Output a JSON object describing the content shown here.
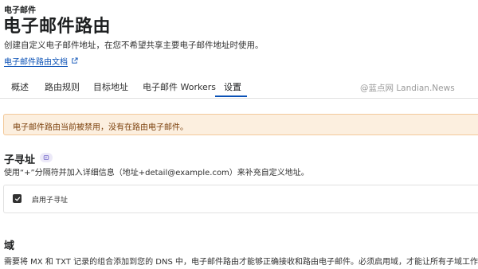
{
  "header": {
    "breadcrumb": "电子邮件",
    "title": "电子邮件路由",
    "subtitle": "创建自定义电子邮件地址，在您不希望共享主要电子邮件地址时使用。",
    "docs_link": "电子邮件路由文档"
  },
  "tabs": [
    {
      "label": "概述"
    },
    {
      "label": "路由规则"
    },
    {
      "label": "目标地址"
    },
    {
      "label": "电子邮件 Workers"
    },
    {
      "label": "设置"
    }
  ],
  "active_tab": "设置",
  "watermark": "@蓝点网 Landian.News",
  "alert": {
    "text": "电子邮件路由当前被禁用，没有在路由电子邮件。"
  },
  "subaddressing": {
    "title": "子寻址",
    "description": "使用“+”分隔符并加入详细信息（地址+detail@example.com）来补充自定义地址。",
    "checkbox_label": "启用子寻址",
    "checked": true
  },
  "domain_section": {
    "title": "域",
    "description": "需要将 MX 和 TXT 记录的组合添加到您的 DNS 中，电子邮件路由才能够正确接收和路由电子邮件。必须启用域，才能让所有子域工作"
  },
  "colors": {
    "accent": "#0a51b6",
    "alert_bg": "#fcefdf",
    "alert_border": "#f3c99a",
    "alert_text": "#7a3f0b"
  }
}
